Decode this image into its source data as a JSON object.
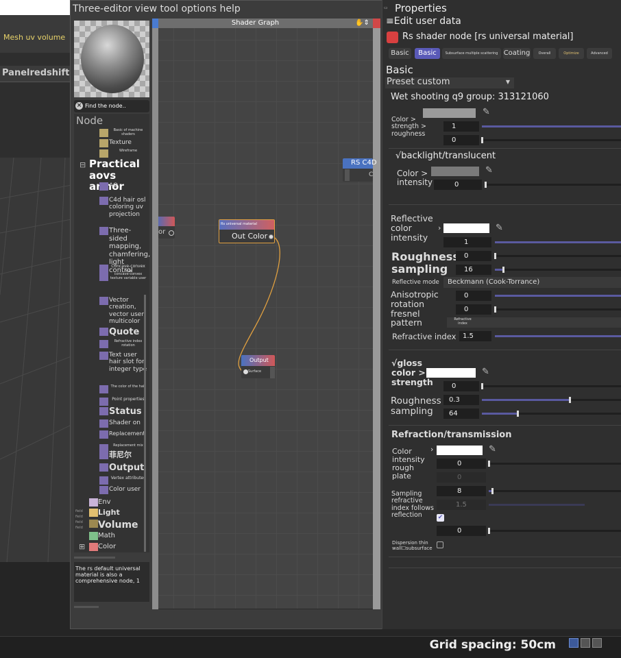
{
  "viewport": {
    "mesh_menu": "Mesh uv volume",
    "panel_label": "Panelredshift",
    "grid_spacing": "Grid spacing: 50cm"
  },
  "window": {
    "title": "Three-editor view tool options help",
    "find_placeholder": "Find the node..",
    "tree_header": "Node",
    "tree": [
      {
        "label": "Basic of machine shaders",
        "color": "#b8a66a"
      },
      {
        "label": "Texture",
        "color": "#b8a66a"
      },
      {
        "label": "Wireframe",
        "color": "#b8a66a"
      },
      {
        "label": "Practical aovs armor",
        "group": true
      },
      {
        "label": "AO",
        "color": "#7c6cae"
      },
      {
        "label": "C4d hair osl coloring uv projection",
        "color": "#7c6cae"
      },
      {
        "label": "Three-sided mapping, chamfering, light control",
        "color": "#7c6cae"
      },
      {
        "label": "Concave-convex mix",
        "color": "#7c6cae"
      },
      {
        "label": "concave-convex texture variable user",
        "color": "#7c6cae"
      },
      {
        "label": "Vector creation, vector user, multicolor",
        "color": "#7c6cae"
      },
      {
        "label": "Quote",
        "color": "#7c6cae"
      },
      {
        "label": "Refractive index rotation",
        "color": "#7c6cae"
      },
      {
        "label": "Text user hair slot for integer type",
        "color": "#7c6cae"
      },
      {
        "label": "The color of the hair",
        "color": "#7c6cae"
      },
      {
        "label": "Point properties",
        "color": "#7c6cae"
      },
      {
        "label": "Status",
        "color": "#7c6cae"
      },
      {
        "label": "Shader on",
        "color": "#7c6cae"
      },
      {
        "label": "Replacement",
        "color": "#7c6cae"
      },
      {
        "label": "Replacement mix",
        "color": "#7c6cae"
      },
      {
        "label": "菲尼尔",
        "color": "#7c6cae"
      },
      {
        "label": "Output",
        "color": "#7c6cae"
      },
      {
        "label": "Vertex attributes",
        "color": "#7c6cae"
      },
      {
        "label": "Color user",
        "color": "#7c6cae"
      },
      {
        "label": "Env",
        "color": "#c9b4d8"
      },
      {
        "label": "Light",
        "color": "#e2c070"
      },
      {
        "label": "Volume",
        "color": "#9b8850"
      },
      {
        "label": "Math",
        "color": "#7fc08a"
      },
      {
        "label": "Color",
        "color": "#e07a7a"
      }
    ],
    "side_labels": [
      "field",
      "field",
      "field",
      "field"
    ],
    "help_text": "The rs default universal material is also a comprehensive node, 1"
  },
  "graph": {
    "title": "Shader Graph",
    "nodes": {
      "rs_c4d": {
        "title": "RS C4D",
        "port": "C"
      },
      "left_partial": {
        "port": "or"
      },
      "material": {
        "title": "Rs universal material",
        "port": "Out Color"
      },
      "output": {
        "title": "Output",
        "port": "Surface"
      }
    }
  },
  "properties": {
    "header": "Properties",
    "edit_user_data": "Edit user data",
    "node_title": "Rs shader node [rs universal material]",
    "tabs": [
      "Basic",
      "Basic",
      "Subsurface multiple scattering",
      "Coating",
      "Overall",
      "Optimize",
      "Advanced"
    ],
    "section": "Basic",
    "preset": "Preset custom",
    "group": "Wet shooting q9 group: 313121060",
    "diffuse": {
      "label": "Color > strength > roughness",
      "strength": "1",
      "roughness": "0"
    },
    "backlight": {
      "title": "√backlight/translucent",
      "label": "Color > intensity",
      "value": "0"
    },
    "reflection": {
      "label": "Reflective color intensity",
      "intensity": "1",
      "roughness_label": "Roughness sampling",
      "roughness": "0",
      "sampling": "16",
      "mode_label": "Reflective mode",
      "mode": "Beckmann (Cook-Torrance)",
      "aniso_label": "Anisotropic rotation fresnel pattern",
      "aniso": "0",
      "rotation": "0",
      "fresnel_mode": "Refractive index",
      "ior_label": "Refractive index",
      "ior": "1.5"
    },
    "gloss": {
      "title": "√gloss color > strength",
      "strength": "0",
      "roughness_label": "Roughness sampling",
      "roughness": "0.3",
      "sampling": "64"
    },
    "refraction": {
      "title": "Refraction/transmission",
      "label": "Color intensity rough plate",
      "intensity": "0",
      "roughness": "0",
      "sampling_label": "Sampling refractive index follows reflection",
      "sampling": "8",
      "ior": "1.5",
      "plate": "0",
      "dispersion_label": "Dispersion thin wall☐subsurface"
    }
  }
}
